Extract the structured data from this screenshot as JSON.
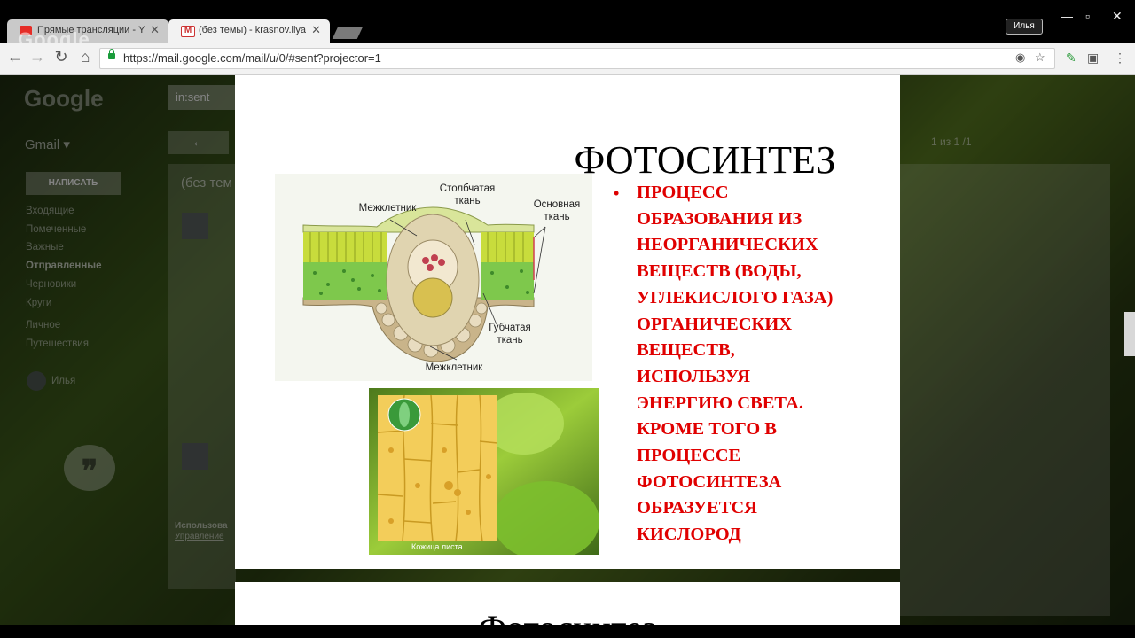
{
  "browser": {
    "tabs": [
      {
        "title": "Прямые трансляции - Y",
        "favicon": "youtube-icon"
      },
      {
        "title": "(без темы) - krasnov.ilya",
        "favicon": "gmail-icon"
      }
    ],
    "profile_name": "Илья",
    "watermark": "Google",
    "url": "https://mail.google.com/mail/u/0/#sent?projector=1"
  },
  "gmail": {
    "logo": "Google",
    "search_value": "in:sent",
    "app_name": "Gmail ▾",
    "compose_label": "НАПИСАТЬ",
    "folders": [
      "Входящие",
      "Помеченные",
      "Важные",
      "Отправленные",
      "Черновики",
      "Круги",
      "Личное",
      "Путешествия"
    ],
    "subject": "(без тем",
    "pager": "1 из 1 /1",
    "user_name": "Илья",
    "footer_text": "Использова",
    "footer_link": "Управление"
  },
  "slide": {
    "title": "ФОТОСИНТЕЗ",
    "diagram_labels": {
      "palisade": "Столбчатая\nткань",
      "intercellular_top": "Межклетник",
      "ground": "Основная\nткань",
      "spongy": "Губчатая\nткань",
      "intercellular_bottom": "Межклетник"
    },
    "photo_caption": "Кожица листа",
    "bullet": "•",
    "text": "ПРОЦЕСС\nОБРАЗОВАНИЯ ИЗ\nНЕОРГАНИЧЕСКИХ\nВЕЩЕСТВ (ВОДЫ,\nУГЛЕКИСЛОГО ГАЗА)\nОРГАНИЧЕСКИХ\nВЕЩЕСТВ,\n ИСПОЛЬЗУЯ\nЭНЕРГИЮ СВЕТА.\nКРОМЕ ТОГО В\nПРОЦЕССЕ\nФОТОСИНТЕЗА\nОБРАЗУЕТСЯ\nКИСЛОРОД",
    "text_color": "#e00000",
    "next_slide_title": "Фотосинтез"
  }
}
